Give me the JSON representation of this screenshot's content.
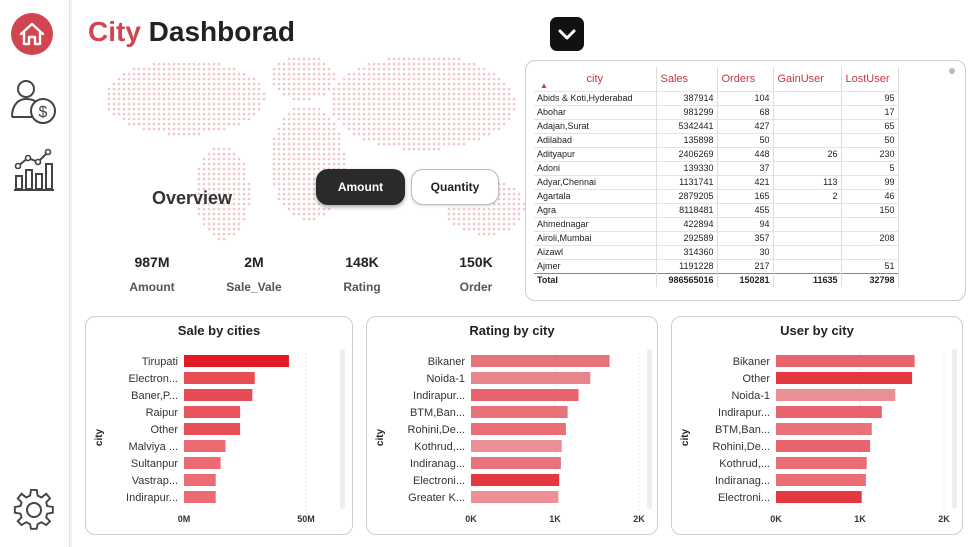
{
  "sidebar": {
    "items": [
      {
        "icon": "home-icon",
        "color": "#d04550"
      },
      {
        "icon": "user-money-icon"
      },
      {
        "icon": "bar-chart-icon"
      },
      {
        "icon": "gear-icon"
      }
    ]
  },
  "header": {
    "title_accent": "City",
    "title_rest": " Dashborad"
  },
  "overview": {
    "label": "Overview"
  },
  "toggle": {
    "amount_label": "Amount",
    "quantity_label": "Quantity",
    "selected": "Amount"
  },
  "kpis": [
    {
      "value": "987M",
      "label": "Amount"
    },
    {
      "value": "2M",
      "label": "Sale_Vale"
    },
    {
      "value": "148K",
      "label": "Rating"
    },
    {
      "value": "150K",
      "label": "Order"
    }
  ],
  "table": {
    "headers": [
      "city",
      "Sales",
      "Orders",
      "GainUser",
      "LostUser"
    ],
    "rows": [
      [
        "Abids & Koti,Hyderabad",
        "387914",
        "104",
        "",
        "95"
      ],
      [
        "Abohar",
        "981299",
        "68",
        "",
        "17"
      ],
      [
        "Adajan,Surat",
        "5342441",
        "427",
        "",
        "65"
      ],
      [
        "Adilabad",
        "135898",
        "50",
        "",
        "50"
      ],
      [
        "Adityapur",
        "2406269",
        "448",
        "26",
        "230"
      ],
      [
        "Adoni",
        "139330",
        "37",
        "",
        "5"
      ],
      [
        "Adyar,Chennai",
        "1131741",
        "421",
        "113",
        "99"
      ],
      [
        "Agartala",
        "2879205",
        "165",
        "2",
        "46"
      ],
      [
        "Agra",
        "8118481",
        "455",
        "",
        "150"
      ],
      [
        "Ahmednagar",
        "422894",
        "94",
        "",
        ""
      ],
      [
        "Airoli,Mumbai",
        "292589",
        "357",
        "",
        "208"
      ],
      [
        "Aizawl",
        "314360",
        "30",
        "",
        ""
      ],
      [
        "Ajmer",
        "1191228",
        "217",
        "",
        "51"
      ]
    ],
    "total": [
      "Total",
      "986565016",
      "150281",
      "11635",
      "32798"
    ]
  },
  "chart_data": [
    {
      "type": "bar",
      "title": "Sale by cities",
      "ylabel": "city",
      "categories": [
        "Tirupati",
        "Electron...",
        "Baner,P...",
        "Raipur",
        "Other",
        "Malviya ...",
        "Sultanpur",
        "Vastrap...",
        "Indirapur..."
      ],
      "values": [
        43,
        29,
        28,
        23,
        23,
        17,
        15,
        13,
        13
      ],
      "value_unit": "M",
      "ticks": [
        "0M",
        "50M"
      ],
      "xlim": [
        0,
        50
      ],
      "colors": [
        "#e01b24",
        "#e84c55",
        "#e64a53",
        "#e8555e",
        "#e65059",
        "#ec6a72",
        "#ec6a72",
        "#ec6a72",
        "#ec6a72"
      ]
    },
    {
      "type": "bar",
      "title": "Rating by city",
      "ylabel": "city",
      "categories": [
        "Bikaner",
        "Noida-1",
        "Indirapur...",
        "BTM,Ban...",
        "Rohini,De...",
        "Kothrud,...",
        "Indiranag...",
        "Electroni...",
        "Greater K..."
      ],
      "values": [
        1650,
        1420,
        1280,
        1150,
        1130,
        1080,
        1070,
        1050,
        1040
      ],
      "ticks": [
        "0K",
        "1K",
        "2K"
      ],
      "xlim": [
        0,
        2000
      ],
      "colors": [
        "#e8727a",
        "#e8848b",
        "#e8636b",
        "#e8727a",
        "#e86d75",
        "#ea8f96",
        "#e8727a",
        "#e43841",
        "#ec9096"
      ]
    },
    {
      "type": "bar",
      "title": "User by city",
      "ylabel": "city",
      "categories": [
        "Bikaner",
        "Other",
        "Noida-1",
        "Indirapur...",
        "BTM,Ban...",
        "Rohini,De...",
        "Kothrud,...",
        "Indiranag...",
        "Electroni..."
      ],
      "values": [
        1650,
        1620,
        1420,
        1260,
        1140,
        1120,
        1080,
        1070,
        1020
      ],
      "ticks": [
        "0K",
        "1K",
        "2K"
      ],
      "xlim": [
        0,
        2000
      ],
      "colors": [
        "#e8636b",
        "#e43841",
        "#ea8f96",
        "#e8636b",
        "#e8727a",
        "#e8636b",
        "#e86d75",
        "#e86d75",
        "#e43841"
      ]
    }
  ]
}
